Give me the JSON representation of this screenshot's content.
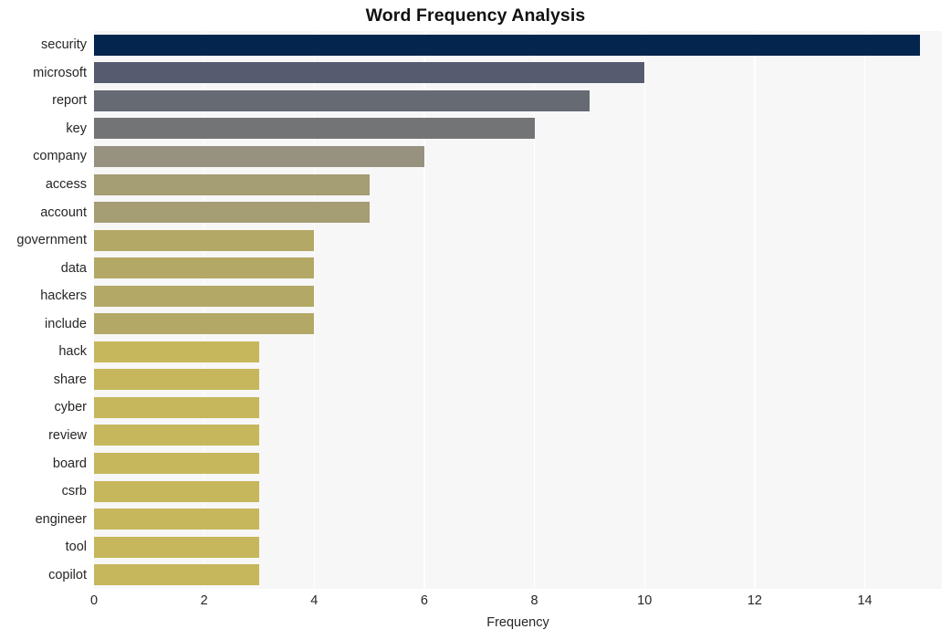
{
  "chart_data": {
    "type": "bar",
    "orientation": "horizontal",
    "title": "Word Frequency Analysis",
    "xlabel": "Frequency",
    "ylabel": "",
    "categories": [
      "security",
      "microsoft",
      "report",
      "key",
      "company",
      "access",
      "account",
      "government",
      "data",
      "hackers",
      "include",
      "hack",
      "share",
      "cyber",
      "review",
      "board",
      "csrb",
      "engineer",
      "tool",
      "copilot"
    ],
    "values": [
      15,
      10,
      9,
      8,
      6,
      5,
      5,
      4,
      4,
      4,
      4,
      3,
      3,
      3,
      3,
      3,
      3,
      3,
      3,
      3
    ],
    "bar_colors": [
      "#04254e",
      "#565b70",
      "#666a72",
      "#737476",
      "#979280",
      "#a59d73",
      "#a59d73",
      "#b3a866",
      "#b3a866",
      "#b3a866",
      "#b3a866",
      "#c6b75c",
      "#c6b75c",
      "#c6b75c",
      "#c6b75c",
      "#c6b75c",
      "#c6b75c",
      "#c6b75c",
      "#c6b75c",
      "#c6b75c"
    ],
    "xlim": [
      0,
      15.4
    ],
    "xticks": [
      0,
      2,
      4,
      6,
      8,
      10,
      12,
      14
    ],
    "xtick_labels": [
      "0",
      "2",
      "4",
      "6",
      "8",
      "10",
      "12",
      "14"
    ],
    "grid": "vertical-only",
    "legend": null,
    "plot_background": "#f7f7f7",
    "gridline_color": "#ffffff",
    "figure_background": "#ffffff",
    "text_color": "#262626"
  }
}
